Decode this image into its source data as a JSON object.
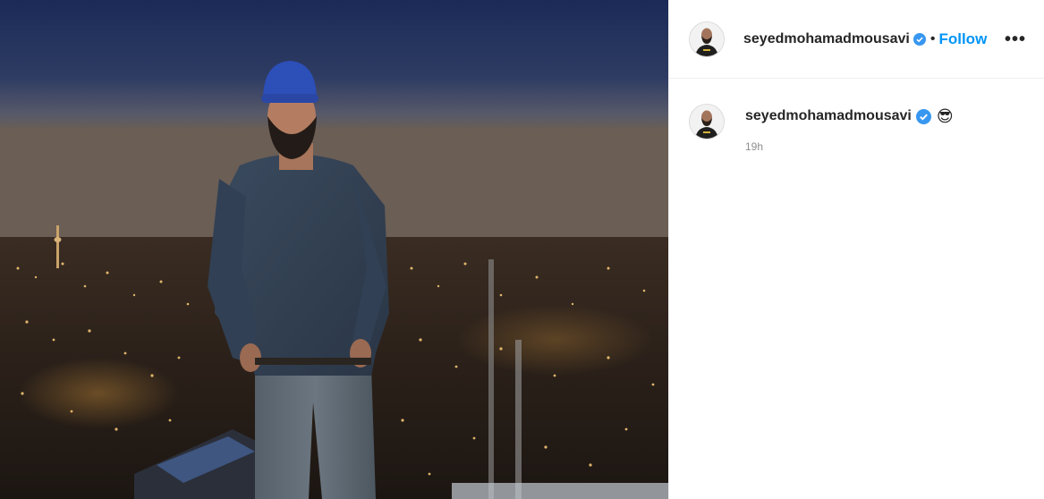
{
  "post": {
    "photo_alt": "",
    "header": {
      "username": "seyedmohamadmousavi",
      "separator": "•",
      "follow_label": "Follow",
      "more_label": "•••"
    },
    "caption": {
      "username": "seyedmohamadmousavi",
      "text": "😎",
      "time": "19h"
    },
    "icons": {
      "verified": "verified-badge-icon",
      "more": "more-options-icon"
    },
    "colors": {
      "follow": "#0095f6",
      "verified": "#3897f0",
      "text": "#262626",
      "muted": "#8e8e8e"
    }
  }
}
